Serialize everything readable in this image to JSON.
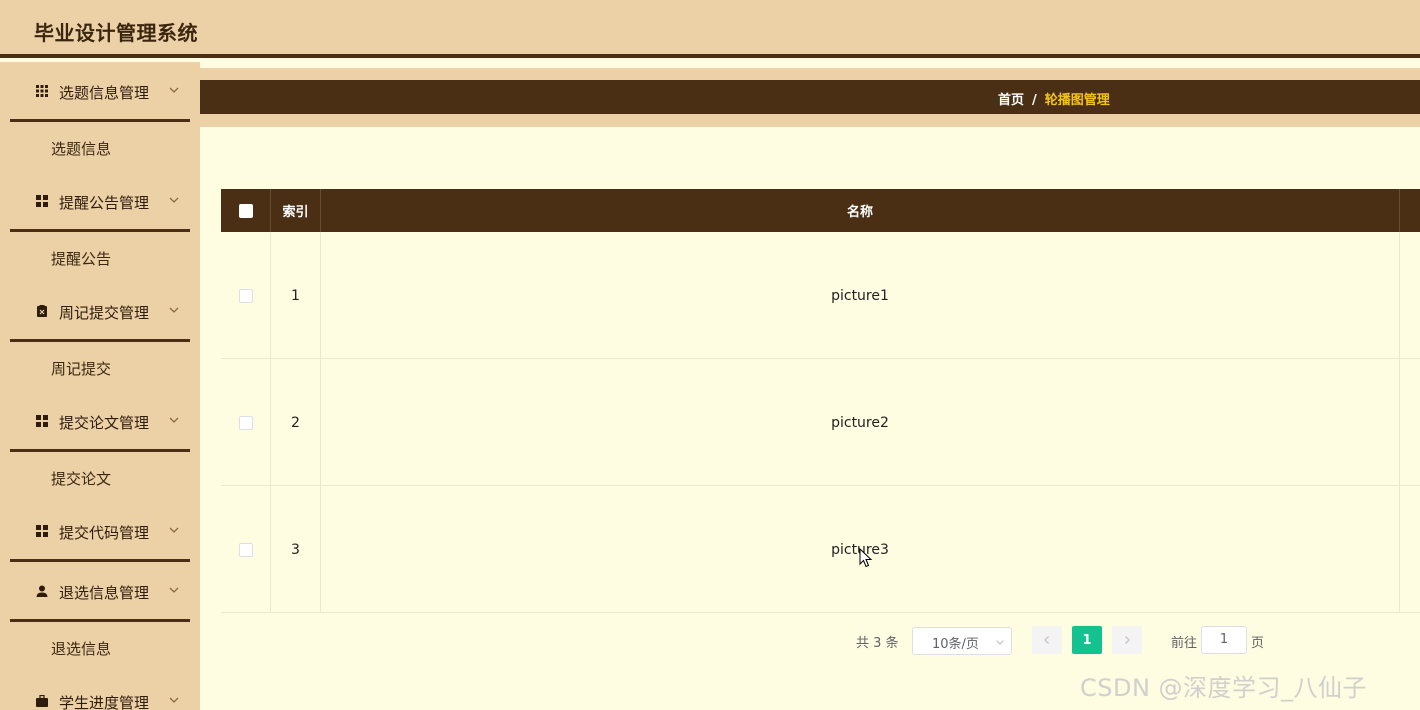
{
  "app": {
    "title": "毕业设计管理系统"
  },
  "sidebar": {
    "groups": [
      {
        "label": "选题信息管理",
        "icon": "grid-icon",
        "sub": "选题信息"
      },
      {
        "label": "提醒公告管理",
        "icon": "apps-icon",
        "sub": "提醒公告"
      },
      {
        "label": "周记提交管理",
        "icon": "clipboard-icon",
        "sub": "周记提交"
      },
      {
        "label": "提交论文管理",
        "icon": "apps-icon",
        "sub": "提交论文"
      },
      {
        "label": "提交代码管理",
        "icon": "apps-icon",
        "sub": ""
      },
      {
        "label": "退选信息管理",
        "icon": "user-icon",
        "sub": "退选信息"
      },
      {
        "label": "学生进度管理",
        "icon": "briefcase-icon",
        "sub": ""
      }
    ]
  },
  "breadcrumb": {
    "home": "首页",
    "separator": "/",
    "current": "轮播图管理"
  },
  "table": {
    "columns": [
      "",
      "索引",
      "名称"
    ],
    "rows": [
      {
        "index": "1",
        "name": "picture1"
      },
      {
        "index": "2",
        "name": "picture2"
      },
      {
        "index": "3",
        "name": "picture3"
      }
    ]
  },
  "pagination": {
    "total_text": "共 3 条",
    "page_size": "10条/页",
    "current_page": "1",
    "goto_label": "前往",
    "goto_value": "1",
    "goto_suffix": "页"
  },
  "watermark": "CSDN @深度学习_八仙子",
  "colors": {
    "accent_dark": "#4a2f15",
    "sidebar_bg": "#ecd0a6",
    "page_bg": "#fefce1",
    "active_page": "#13c28e",
    "crumb_current": "#f5c318"
  }
}
